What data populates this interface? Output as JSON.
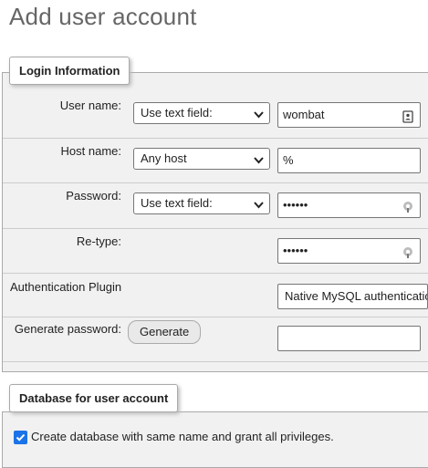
{
  "page": {
    "title": "Add user account"
  },
  "login": {
    "legend": "Login Information",
    "user": {
      "label": "User name:",
      "select": "Use text field:",
      "value": "wombat"
    },
    "host": {
      "label": "Host name:",
      "select": "Any host",
      "value": "%"
    },
    "password": {
      "label": "Password:",
      "select": "Use text field:",
      "value": "••••••"
    },
    "retype": {
      "label": "Re-type:",
      "value": "••••••"
    },
    "auth": {
      "label": "Authentication Plugin",
      "value": "Native MySQL authenticatio"
    },
    "generate": {
      "label": "Generate password:",
      "button": "Generate",
      "value": ""
    }
  },
  "database": {
    "legend": "Database for user account",
    "create_checkbox": {
      "checked": true,
      "label": "Create database with same name and grant all privileges."
    }
  },
  "icons": {
    "contact_card": "contact-card-icon",
    "key_eye": "password-key-icon",
    "chevron": "chevron-down-icon",
    "check": "check-icon"
  },
  "colors": {
    "checkbox": "#1a73e8",
    "fieldset_bg": "#f1f1f1"
  }
}
